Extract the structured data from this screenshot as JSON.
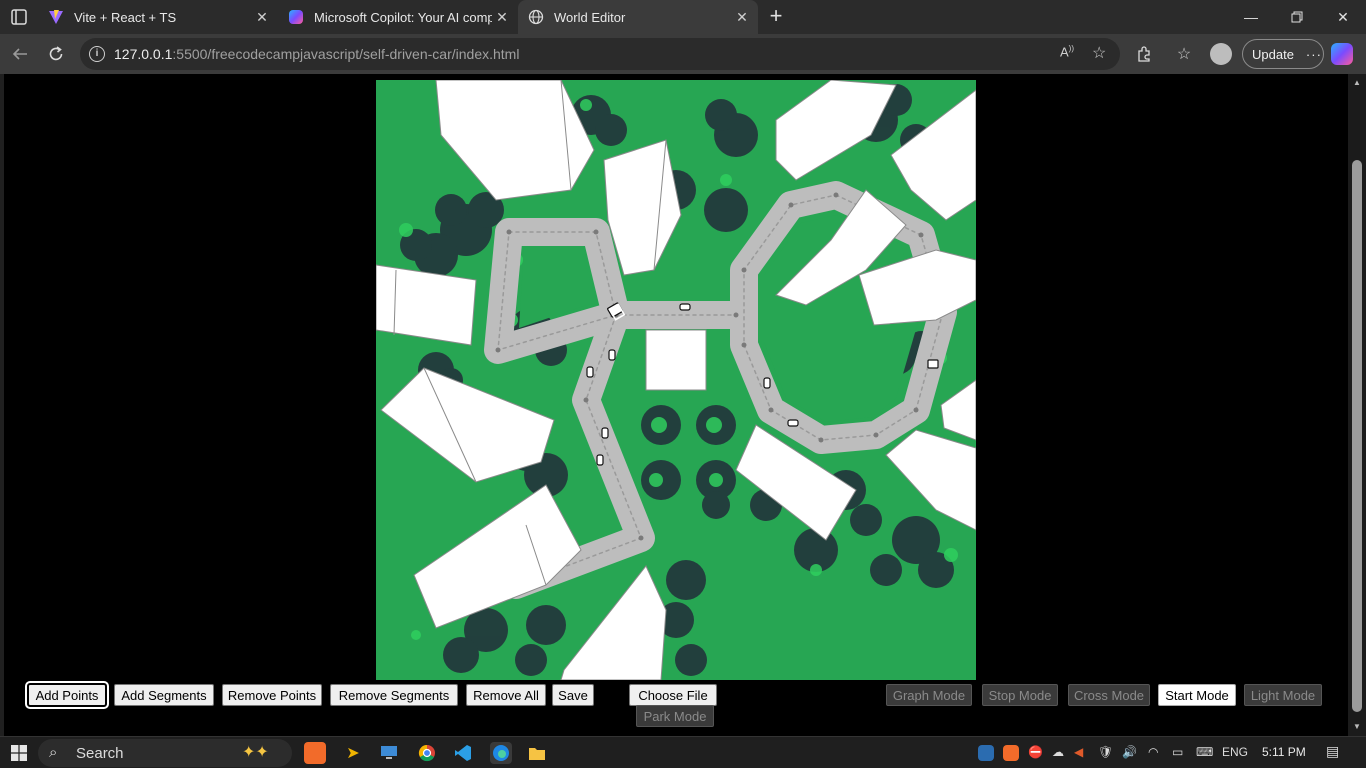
{
  "browser": {
    "tabs": [
      {
        "title": "Vite + React + TS",
        "icon": "vite-icon",
        "active": false
      },
      {
        "title": "Microsoft Copilot: Your AI compa",
        "icon": "copilot-icon",
        "active": false
      },
      {
        "title": "World Editor",
        "icon": "globe-icon",
        "active": true
      }
    ],
    "url_host": "127.0.0.1",
    "url_rest": ":5500/freecodecampjavascript/self-driven-car/index.html",
    "update_label": "Update",
    "more_label": "···"
  },
  "toolbar": {
    "add_points": "Add Points",
    "add_segments": "Add Segments",
    "remove_points": "Remove Points",
    "remove_segments": "Remove Segments",
    "remove_all": "Remove All",
    "save": "Save",
    "choose_file": "Choose File"
  },
  "modes": {
    "graph": "Graph Mode",
    "stop": "Stop Mode",
    "cross": "Cross Mode",
    "start": "Start Mode",
    "light": "Light Mode",
    "park": "Park Mode",
    "active": "Start Mode"
  },
  "taskbar": {
    "search_placeholder": "Search",
    "language": "ENG",
    "time": "5:11 PM"
  },
  "colors": {
    "grass": "#27a653",
    "road": "#bbbbbb",
    "building": "#ffffff",
    "tree_dark": "#1f3b3d"
  }
}
